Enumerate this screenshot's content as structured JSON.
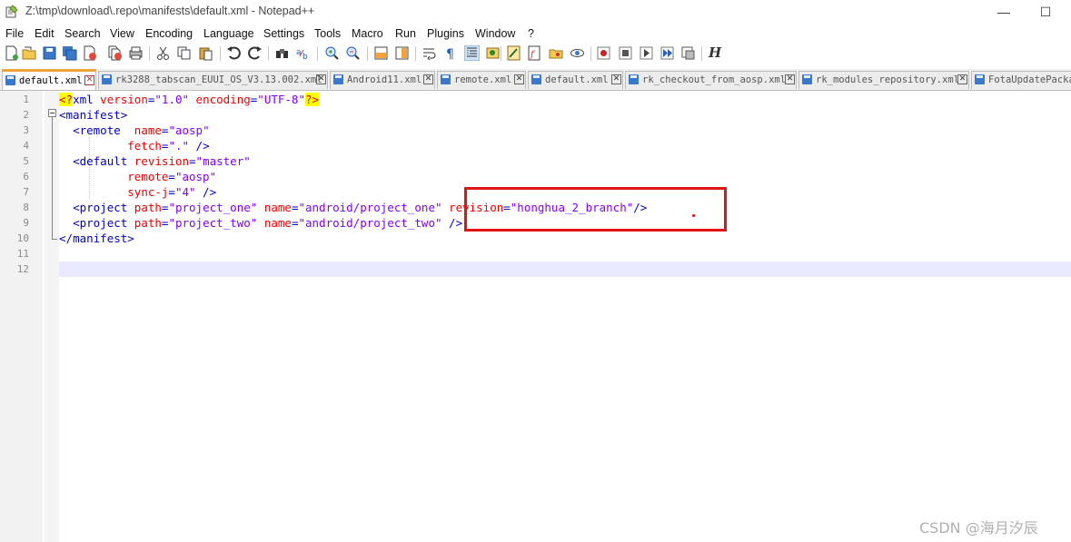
{
  "window": {
    "title": "Z:\\tmp\\download\\.repo\\manifests\\default.xml - Notepad++",
    "minimize_glyph": "—",
    "maximize_glyph": "☐"
  },
  "menu": [
    "File",
    "Edit",
    "Search",
    "View",
    "Encoding",
    "Language",
    "Settings",
    "Tools",
    "Macro",
    "Run",
    "Plugins",
    "Window",
    "?"
  ],
  "toolbar": {
    "icons": [
      "new-file-icon",
      "open-file-icon",
      "save-icon",
      "save-all-icon",
      "close-icon",
      "close-all-icon",
      "print-icon",
      "cut-icon",
      "copy-icon",
      "paste-icon",
      "undo-icon",
      "redo-icon",
      "find-icon",
      "replace-icon",
      "zoom-in-icon",
      "zoom-out-icon",
      "sync-vertical-icon",
      "sync-horizontal-icon",
      "word-wrap-icon",
      "show-all-chars-icon",
      "indent-guide-icon",
      "user-define-icon",
      "document-map-icon",
      "function-list-icon",
      "folder-workspace-icon",
      "monitoring-icon",
      "record-macro-icon",
      "stop-macro-icon",
      "play-macro-icon",
      "run-macro-multiple-icon",
      "save-macro-icon",
      "h-icon"
    ],
    "h_glyph": "H"
  },
  "tabs": [
    {
      "label": "default.xml",
      "active": true
    },
    {
      "label": "rk3288_tabscan_EUUI_OS_V3.13.002.xml",
      "active": false
    },
    {
      "label": "Android11.xml",
      "active": false
    },
    {
      "label": "remote.xml",
      "active": false
    },
    {
      "label": "default.xml",
      "active": false
    },
    {
      "label": "rk_checkout_from_aosp.xml",
      "active": false
    },
    {
      "label": "rk_modules_repository.xml",
      "active": false
    },
    {
      "label": "FotaUpdatePacka",
      "active": false
    }
  ],
  "tab_close_glyph": "✕",
  "editor": {
    "line_numbers": [
      "1",
      "2",
      "3",
      "4",
      "5",
      "6",
      "7",
      "8",
      "9",
      "10",
      "11",
      "12"
    ],
    "lines": {
      "l1": {
        "pi_open": "<?",
        "tag": "xml",
        "a1": " version",
        "eq1": "=",
        "v1": "\"1.0\"",
        "a2": " encoding",
        "eq2": "=",
        "v2": "\"UTF-8\"",
        "pi_close": "?>"
      },
      "l2": {
        "open": "<",
        "tag": "manifest",
        "close": ">"
      },
      "l3": {
        "indent": "  ",
        "open": "<",
        "tag": "remote",
        "a1": "  name",
        "eq1": "=",
        "v1": "\"aosp\""
      },
      "l4": {
        "indent": "          ",
        "a1": "fetch",
        "eq1": "=",
        "v1": "\".\"",
        "close": " />"
      },
      "l5": {
        "indent": "  ",
        "open": "<",
        "tag": "default",
        "a1": " revision",
        "eq1": "=",
        "v1": "\"master\""
      },
      "l6": {
        "indent": "          ",
        "a1": "remote",
        "eq1": "=",
        "v1": "\"aosp\""
      },
      "l7": {
        "indent": "          ",
        "a1": "sync-j",
        "eq1": "=",
        "v1": "\"4\"",
        "close": " />"
      },
      "l8": {
        "indent": "  ",
        "open": "<",
        "tag": "project",
        "a1": " path",
        "eq1": "=",
        "v1": "\"project_one\"",
        "a2": " name",
        "eq2": "=",
        "v2": "\"android/project_one\"",
        "a3": " revision",
        "eq3": "=",
        "v3": "\"honghua_2_branch\"",
        "close": "/>"
      },
      "l9": {
        "indent": "  ",
        "open": "<",
        "tag": "project",
        "a1": " path",
        "eq1": "=",
        "v1": "\"project_two\"",
        "a2": " name",
        "eq2": "=",
        "v2": "\"android/project_two\"",
        "close": " />"
      },
      "l10": {
        "open": "</",
        "tag": "manifest",
        "close": ">"
      }
    }
  },
  "watermark": "CSDN @海月汐辰"
}
